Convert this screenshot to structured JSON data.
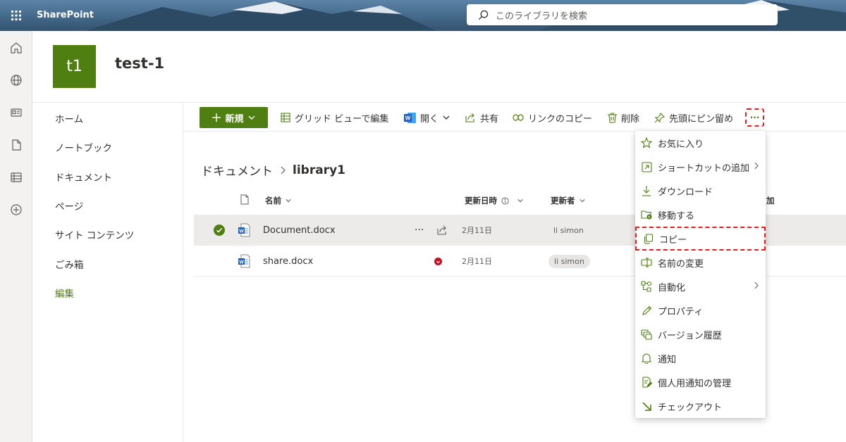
{
  "topbar": {
    "app_name": "SharePoint",
    "search_placeholder": "このライブラリを検索"
  },
  "site": {
    "logo_initials": "t1",
    "title": "test-1"
  },
  "nav": {
    "items": [
      "ホーム",
      "ノートブック",
      "ドキュメント",
      "ページ",
      "サイト コンテンツ",
      "ごみ箱",
      "編集"
    ]
  },
  "command_bar": {
    "new": "新規",
    "grid_edit": "グリッド ビューで編集",
    "open": "開く",
    "share": "共有",
    "copy_link": "リンクのコピー",
    "delete": "削除",
    "pin": "先頭にピン留め",
    "more": "···"
  },
  "breadcrumb": {
    "parent": "ドキュメント",
    "current": "library1"
  },
  "columns": {
    "name": "名前",
    "modified": "更新日時",
    "modified_by": "更新者",
    "extra": "加"
  },
  "files": [
    {
      "name": "Document.docx",
      "modified": "2月11日",
      "modified_by": "li simon",
      "selected": true
    },
    {
      "name": "share.docx",
      "modified": "2月11日",
      "modified_by": "li simon",
      "selected": false
    }
  ],
  "menu": {
    "items": [
      {
        "label": "お気に入り",
        "icon": "star-icon"
      },
      {
        "label": "ショートカットの追加",
        "icon": "shortcut-icon",
        "submenu": true
      },
      {
        "label": "ダウンロード",
        "icon": "download-icon"
      },
      {
        "label": "移動する",
        "icon": "move-icon"
      },
      {
        "label": "コピー",
        "icon": "copy-icon",
        "highlighted": true
      },
      {
        "label": "名前の変更",
        "icon": "rename-icon"
      },
      {
        "label": "自動化",
        "icon": "automate-icon",
        "submenu": true
      },
      {
        "label": "プロパティ",
        "icon": "pencil-icon"
      },
      {
        "label": "バージョン履歴",
        "icon": "version-history-icon"
      },
      {
        "label": "通知",
        "icon": "bell-icon"
      },
      {
        "label": "個人用通知の管理",
        "icon": "manage-alerts-icon"
      },
      {
        "label": "チェックアウト",
        "icon": "checkout-icon"
      }
    ]
  },
  "colors": {
    "accent": "#4f7e11",
    "highlight_border": "#e0201c",
    "selected_row": "#edebe9"
  }
}
